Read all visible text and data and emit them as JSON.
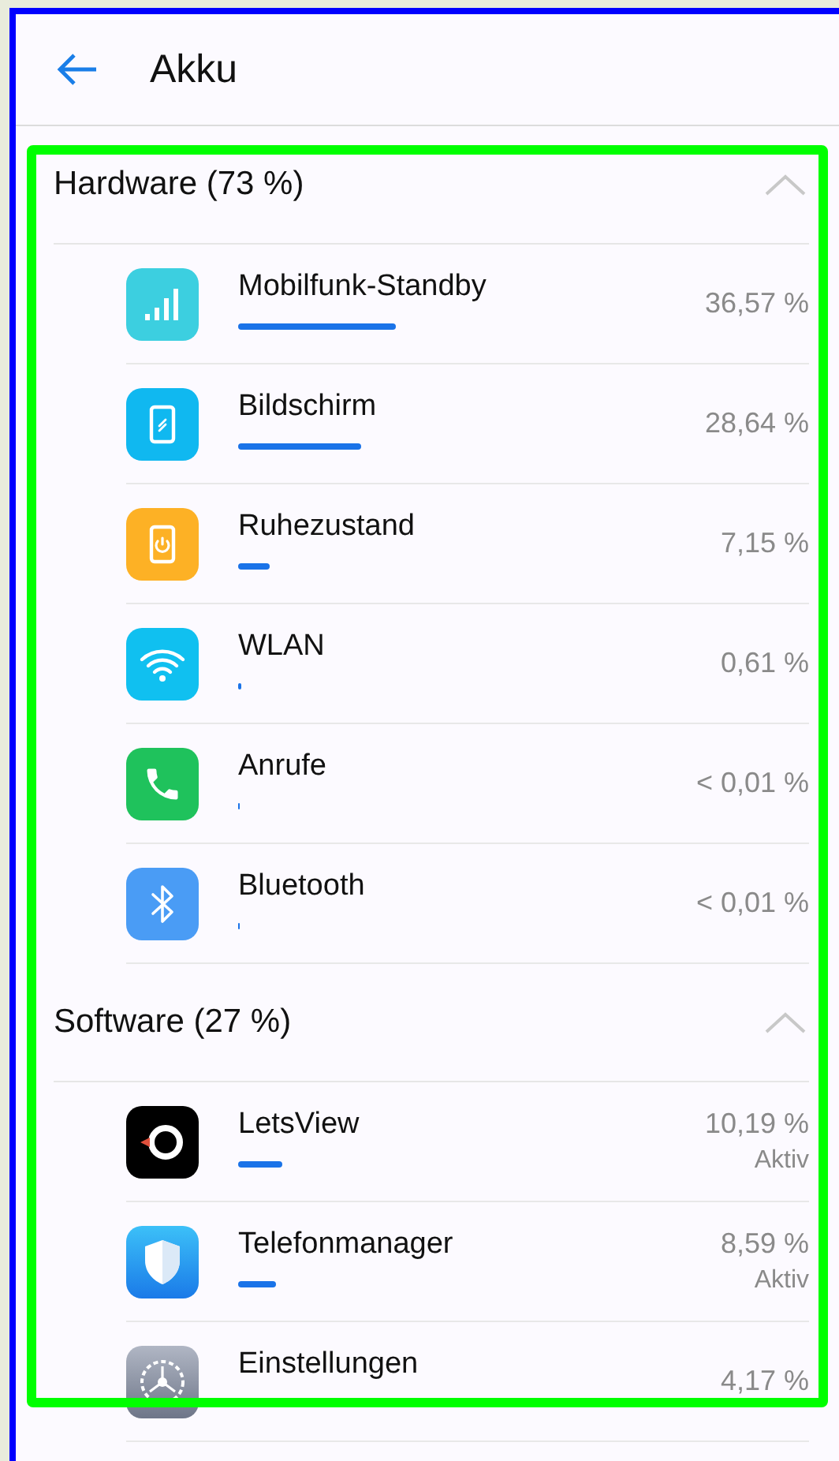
{
  "header": {
    "title": "Akku"
  },
  "sections": [
    {
      "title": "Hardware (73 %)",
      "expanded": true,
      "items": [
        {
          "kind": "signal",
          "name": "Mobilfunk-Standby",
          "percent": "36,57 %"
        },
        {
          "kind": "screen",
          "name": "Bildschirm",
          "percent": "28,64 %"
        },
        {
          "kind": "sleep",
          "name": "Ruhezustand",
          "percent": "7,15 %"
        },
        {
          "kind": "wifi",
          "name": "WLAN",
          "percent": "0,61 %"
        },
        {
          "kind": "phone",
          "name": "Anrufe",
          "percent": "< 0,01 %"
        },
        {
          "kind": "bluetooth",
          "name": "Bluetooth",
          "percent": "< 0,01 %"
        }
      ]
    },
    {
      "title": "Software (27 %)",
      "expanded": true,
      "items": [
        {
          "kind": "letsview",
          "name": "LetsView",
          "percent": "10,19 %",
          "status": "Aktiv"
        },
        {
          "kind": "shield",
          "name": "Telefonmanager",
          "percent": "8,59 %",
          "status": "Aktiv"
        },
        {
          "kind": "gear",
          "name": "Einstellungen",
          "percent": "4,17 %"
        }
      ]
    }
  ]
}
